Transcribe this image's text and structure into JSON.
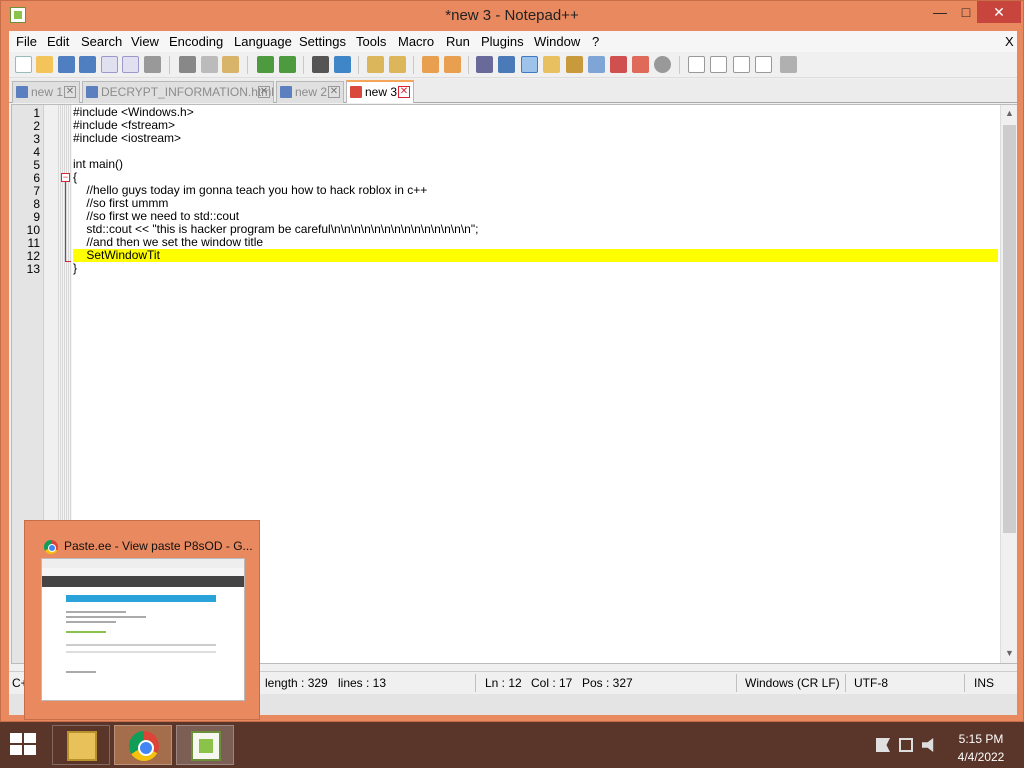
{
  "window": {
    "title": "*new 3 - Notepad++",
    "controls": {
      "minimize": "—",
      "maximize": "□",
      "close": "✕"
    }
  },
  "menu": {
    "items": [
      "File",
      "Edit",
      "Search",
      "View",
      "Encoding",
      "Language",
      "Settings",
      "Tools",
      "Macro",
      "Run",
      "Plugins",
      "Window",
      "?"
    ],
    "close_doc": "X"
  },
  "toolbar": {
    "icons": [
      "new-file-icon",
      "open-file-icon",
      "save-icon",
      "save-all-icon",
      "close-icon",
      "close-all-icon",
      "print-icon",
      "cut-icon",
      "copy-icon",
      "paste-icon",
      "undo-icon",
      "redo-icon",
      "find-icon",
      "replace-icon",
      "zoom-in-icon",
      "zoom-out-icon",
      "sync-vertical-icon",
      "sync-horizontal-icon",
      "word-wrap-icon",
      "show-all-chars-icon",
      "indent-guide-icon",
      "doc-map-icon",
      "function-list-icon",
      "folder-workspace-icon",
      "monitoring-icon",
      "record-macro-icon",
      "stop-record-icon",
      "play-macro-icon",
      "run-multiple-icon",
      "save-macro-icon"
    ]
  },
  "tabs": [
    {
      "label": "new 1",
      "close": "✕",
      "active": false
    },
    {
      "label": "DECRYPT_INFORMATION.html",
      "close": "✕",
      "active": false
    },
    {
      "label": "new 2",
      "close": "✕",
      "active": false
    },
    {
      "label": "new 3",
      "close": "✕",
      "active": true
    }
  ],
  "editor": {
    "fold_marker": "−",
    "current_line": 12,
    "lines": [
      {
        "n": "1",
        "text": "#include <Windows.h>"
      },
      {
        "n": "2",
        "text": "#include <fstream>"
      },
      {
        "n": "3",
        "text": "#include <iostream>"
      },
      {
        "n": "4",
        "text": ""
      },
      {
        "n": "5",
        "text": "int main()"
      },
      {
        "n": "6",
        "text": "{"
      },
      {
        "n": "7",
        "text": "    //hello guys today im gonna teach you how to hack roblox in c++"
      },
      {
        "n": "8",
        "text": "    //so first ummm"
      },
      {
        "n": "9",
        "text": "    //so first we need to std::cout"
      },
      {
        "n": "10",
        "text": "    std::cout << \"this is hacker program be careful\\n\\n\\n\\n\\n\\n\\n\\n\\n\\n\\n\\n\\n\\n\";"
      },
      {
        "n": "11",
        "text": "    //and then we set the window title"
      },
      {
        "n": "12",
        "text": "    SetWindowTit"
      },
      {
        "n": "13",
        "text": "}"
      }
    ]
  },
  "scrollbar": {
    "up": "▲",
    "down": "▼"
  },
  "status": {
    "language": "C+",
    "length": "length : 329",
    "lines": "lines : 13",
    "ln": "Ln : 12",
    "col": "Col : 17",
    "pos": "Pos : 327",
    "eol": "Windows (CR LF)",
    "encoding": "UTF-8",
    "mode": "INS"
  },
  "preview": {
    "title": "Paste.ee - View paste P8sOD - G..."
  },
  "taskbar": {
    "apps": [
      "file-explorer",
      "google-chrome",
      "notepad-plus-plus"
    ],
    "time": "5:15 PM",
    "date": "4/4/2022"
  },
  "colors": {
    "window_frame": "#e9895f",
    "current_line": "#ffff00",
    "taskbar": "#5a362a",
    "fold_marker": "#dd2233"
  }
}
